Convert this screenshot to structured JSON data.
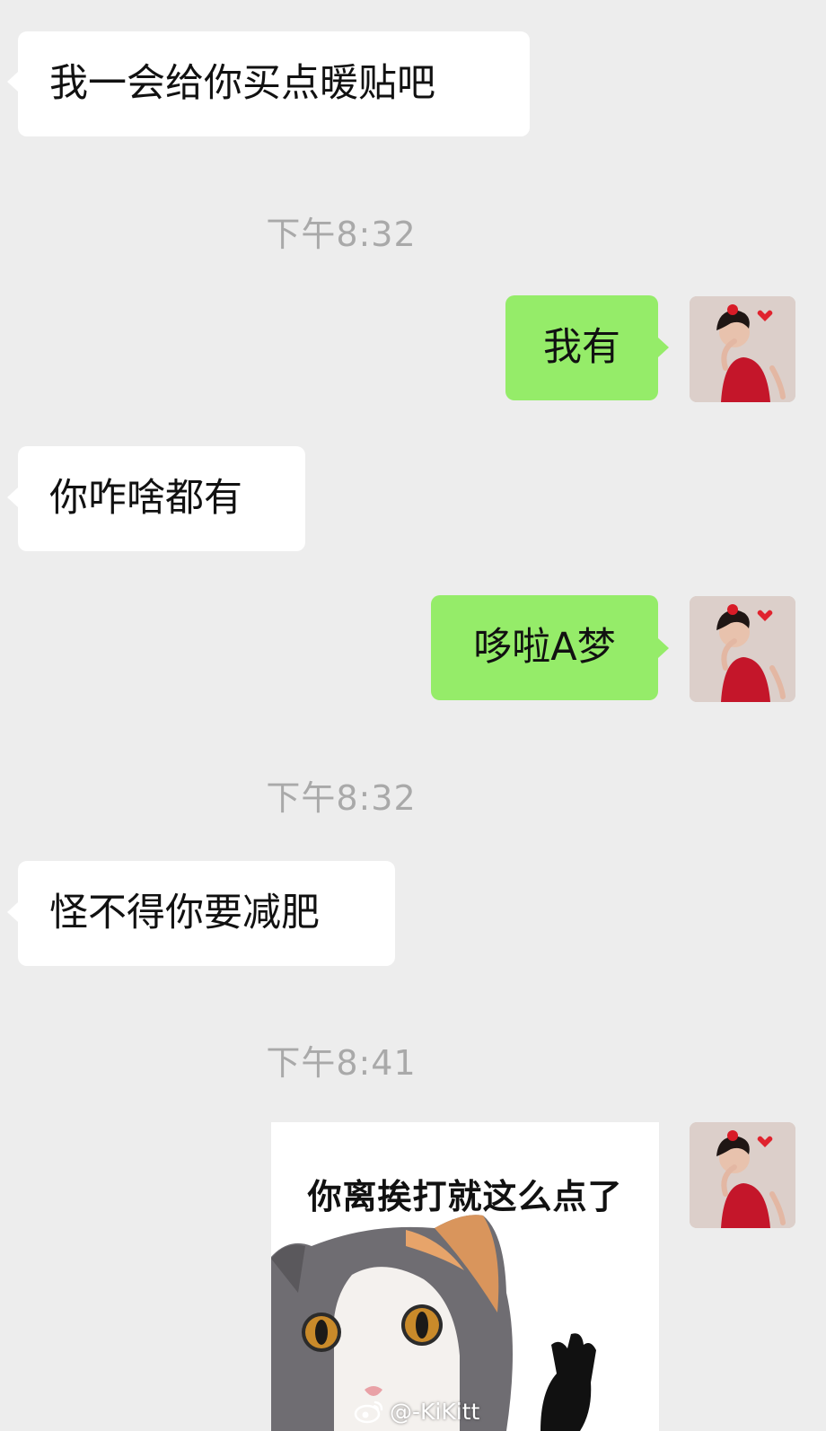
{
  "messages": [
    {
      "kind": "in",
      "text": "我一会给你买点暖贴吧"
    },
    {
      "kind": "time",
      "text": "下午8:32"
    },
    {
      "kind": "out",
      "text": "我有"
    },
    {
      "kind": "in",
      "text": "你咋啥都有"
    },
    {
      "kind": "out",
      "text": "哆啦A梦"
    },
    {
      "kind": "time",
      "text": "下午8:32"
    },
    {
      "kind": "in",
      "text": "怪不得你要减肥"
    },
    {
      "kind": "time",
      "text": "下午8:41"
    },
    {
      "kind": "sticker",
      "caption": "你离挨打就这么点了"
    }
  ],
  "avatar": {
    "icon": "user-avatar-girl-red-dress"
  },
  "watermark": {
    "icon": "weibo-icon",
    "text": "@-KiKitt"
  },
  "colors": {
    "background": "#ededed",
    "incoming_bubble": "#ffffff",
    "outgoing_bubble": "#95ec69",
    "timestamp": "#a9a9a9"
  }
}
